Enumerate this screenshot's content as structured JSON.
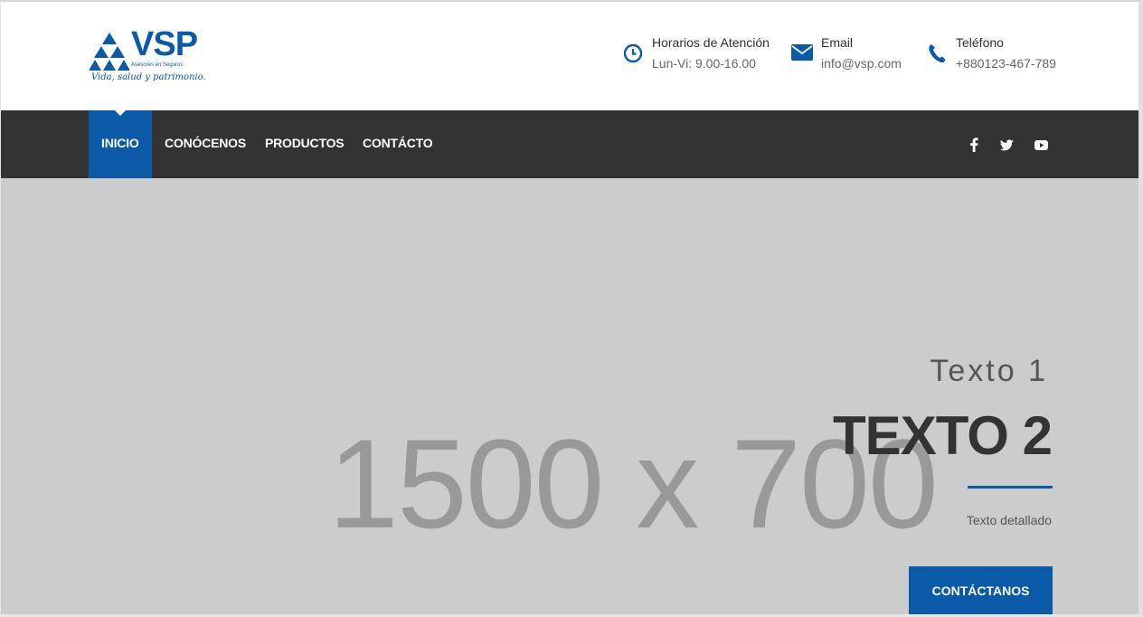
{
  "brand": {
    "name": "VSP",
    "subtitle": "Asesores en Seguros",
    "tagline": "Vida, salud y patrimonio.",
    "color": "#0b5aa8"
  },
  "contact_info": [
    {
      "icon": "clock-icon",
      "label": "Horarios de Atención",
      "value": "Lun-Vi: 9.00-16.00"
    },
    {
      "icon": "envelope-icon",
      "label": "Email",
      "value": "info@vsp.com"
    },
    {
      "icon": "phone-icon",
      "label": "Teléfono",
      "value": "+880123-467-789"
    }
  ],
  "nav": {
    "items": [
      "INICIO",
      "CONÓCENOS",
      "PRODUCTOS",
      "CONTÁCTO"
    ],
    "active": "INICIO",
    "social": [
      "facebook-icon",
      "twitter-icon",
      "youtube-icon"
    ]
  },
  "hero": {
    "placeholder": "1500 x 700",
    "text1": "Texto 1",
    "text2": "TEXTO 2",
    "detail": "Texto detallado",
    "cta": "CONTÁCTANOS"
  },
  "colors": {
    "nav_bg": "#333333",
    "hero_bg": "#cccccc",
    "accent": "#0b5aa8"
  }
}
